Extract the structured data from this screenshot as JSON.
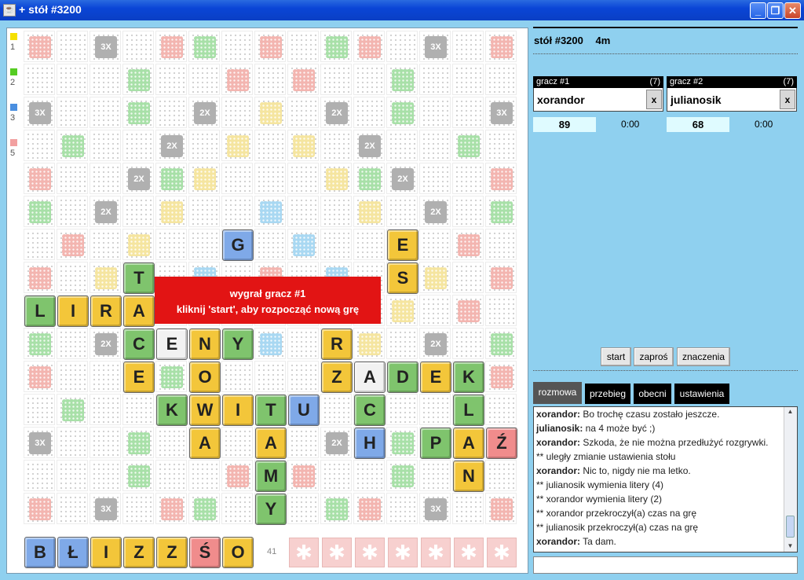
{
  "window": {
    "title": "+ stół #3200",
    "icon": "java-icon",
    "minimize": "_",
    "restore": "❐",
    "close": "✕"
  },
  "legend": [
    {
      "count": "1",
      "color": "#f5e000"
    },
    {
      "count": "2",
      "color": "#55cc22"
    },
    {
      "count": "3",
      "color": "#4a8fe0"
    },
    {
      "count": "5",
      "color": "#f2a0a0"
    }
  ],
  "board": {
    "multipliers": [
      {
        "r": 0,
        "c": 2,
        "label": "3X"
      },
      {
        "r": 0,
        "c": 12,
        "label": "3X"
      },
      {
        "r": 2,
        "c": 0,
        "label": "3X"
      },
      {
        "r": 2,
        "c": 5,
        "label": "2X"
      },
      {
        "r": 2,
        "c": 9,
        "label": "2X"
      },
      {
        "r": 2,
        "c": 14,
        "label": "3X"
      },
      {
        "r": 3,
        "c": 4,
        "label": "2X"
      },
      {
        "r": 3,
        "c": 10,
        "label": "2X"
      },
      {
        "r": 4,
        "c": 3,
        "label": "2X"
      },
      {
        "r": 4,
        "c": 11,
        "label": "2X"
      },
      {
        "r": 5,
        "c": 2,
        "label": "2X"
      },
      {
        "r": 5,
        "c": 12,
        "label": "2X"
      },
      {
        "r": 9,
        "c": 2,
        "label": "2X"
      },
      {
        "r": 9,
        "c": 12,
        "label": "2X"
      },
      {
        "r": 12,
        "c": 0,
        "label": "3X"
      },
      {
        "r": 12,
        "c": 9,
        "label": "2X"
      },
      {
        "r": 14,
        "c": 2,
        "label": "3X"
      },
      {
        "r": 14,
        "c": 12,
        "label": "3X"
      }
    ],
    "tiles": [
      {
        "r": 6,
        "c": 6,
        "l": "G",
        "k": "blue"
      },
      {
        "r": 6,
        "c": 11,
        "l": "E",
        "k": "yellow"
      },
      {
        "r": 7,
        "c": 3,
        "l": "T",
        "k": "green"
      },
      {
        "r": 7,
        "c": 11,
        "l": "S",
        "k": "yellow"
      },
      {
        "r": 8,
        "c": 0,
        "l": "L",
        "k": "green"
      },
      {
        "r": 8,
        "c": 1,
        "l": "I",
        "k": "yellow"
      },
      {
        "r": 8,
        "c": 2,
        "l": "R",
        "k": "yellow"
      },
      {
        "r": 8,
        "c": 3,
        "l": "A",
        "k": "yellow"
      },
      {
        "r": 9,
        "c": 3,
        "l": "C",
        "k": "green"
      },
      {
        "r": 9,
        "c": 4,
        "l": "E",
        "k": "white"
      },
      {
        "r": 9,
        "c": 5,
        "l": "N",
        "k": "yellow"
      },
      {
        "r": 9,
        "c": 6,
        "l": "Y",
        "k": "green"
      },
      {
        "r": 9,
        "c": 9,
        "l": "R",
        "k": "yellow"
      },
      {
        "r": 10,
        "c": 3,
        "l": "E",
        "k": "yellow"
      },
      {
        "r": 10,
        "c": 5,
        "l": "O",
        "k": "yellow"
      },
      {
        "r": 10,
        "c": 9,
        "l": "Z",
        "k": "yellow"
      },
      {
        "r": 10,
        "c": 10,
        "l": "A",
        "k": "white"
      },
      {
        "r": 10,
        "c": 11,
        "l": "D",
        "k": "green"
      },
      {
        "r": 10,
        "c": 12,
        "l": "E",
        "k": "yellow"
      },
      {
        "r": 10,
        "c": 13,
        "l": "K",
        "k": "green"
      },
      {
        "r": 11,
        "c": 4,
        "l": "K",
        "k": "green"
      },
      {
        "r": 11,
        "c": 5,
        "l": "W",
        "k": "yellow"
      },
      {
        "r": 11,
        "c": 6,
        "l": "I",
        "k": "yellow"
      },
      {
        "r": 11,
        "c": 7,
        "l": "T",
        "k": "green"
      },
      {
        "r": 11,
        "c": 8,
        "l": "U",
        "k": "blue"
      },
      {
        "r": 11,
        "c": 10,
        "l": "C",
        "k": "green"
      },
      {
        "r": 11,
        "c": 13,
        "l": "L",
        "k": "green"
      },
      {
        "r": 12,
        "c": 5,
        "l": "A",
        "k": "yellow"
      },
      {
        "r": 12,
        "c": 7,
        "l": "A",
        "k": "yellow"
      },
      {
        "r": 12,
        "c": 10,
        "l": "H",
        "k": "blue"
      },
      {
        "r": 12,
        "c": 12,
        "l": "P",
        "k": "green"
      },
      {
        "r": 12,
        "c": 13,
        "l": "A",
        "k": "yellow"
      },
      {
        "r": 12,
        "c": 14,
        "l": "Ź",
        "k": "red"
      },
      {
        "r": 13,
        "c": 7,
        "l": "M",
        "k": "green"
      },
      {
        "r": 13,
        "c": 13,
        "l": "N",
        "k": "yellow"
      },
      {
        "r": 14,
        "c": 7,
        "l": "Y",
        "k": "green"
      }
    ],
    "overlay": {
      "line1": "wygrał gracz #1",
      "line2": "kliknij 'start', aby rozpocząć nową grę"
    }
  },
  "rack": {
    "tiles": [
      {
        "l": "B",
        "k": "blue"
      },
      {
        "l": "Ł",
        "k": "blue"
      },
      {
        "l": "I",
        "k": "yellow"
      },
      {
        "l": "Z",
        "k": "yellow"
      },
      {
        "l": "Z",
        "k": "yellow"
      },
      {
        "l": "Ś",
        "k": "red"
      },
      {
        "l": "O",
        "k": "yellow"
      }
    ],
    "remaining": "41",
    "slots": [
      "✱",
      "✱",
      "✱",
      "✱",
      "✱",
      "✱",
      "✱"
    ]
  },
  "table": {
    "name": "stół #3200",
    "time": "4m"
  },
  "players": [
    {
      "label": "gracz #1",
      "count": "(7)",
      "name": "xorandor",
      "remove": "x",
      "score": "89",
      "clock": "0:00"
    },
    {
      "label": "gracz #2",
      "count": "(7)",
      "name": "julianosik",
      "remove": "x",
      "score": "68",
      "clock": "0:00"
    }
  ],
  "buttons": {
    "start": "start",
    "invite": "zaproś",
    "meanings": "znaczenia"
  },
  "tabs": [
    "rozmowa",
    "przebieg",
    "obecni",
    "ustawienia"
  ],
  "chat": [
    {
      "user": "xorandor:",
      "text": " Bo trochę czasu zostało jeszcze."
    },
    {
      "user": "julianosik:",
      "text": " na 4 może być ;)"
    },
    {
      "user": "xorandor:",
      "text": " Szkoda, że nie można przedłużyć rozgrywki."
    },
    {
      "user": "",
      "text": "** uległy zmianie ustawienia stołu"
    },
    {
      "user": "xorandor:",
      "text": " Nic to, nigdy nie ma letko."
    },
    {
      "user": "",
      "text": "** julianosik wymienia litery (4)"
    },
    {
      "user": "",
      "text": "** xorandor wymienia litery (2)"
    },
    {
      "user": "",
      "text": "** xorandor przekroczył(a) czas na grę"
    },
    {
      "user": "",
      "text": "** julianosik przekroczył(a) czas na grę"
    },
    {
      "user": "xorandor:",
      "text": " Ta dam."
    }
  ]
}
